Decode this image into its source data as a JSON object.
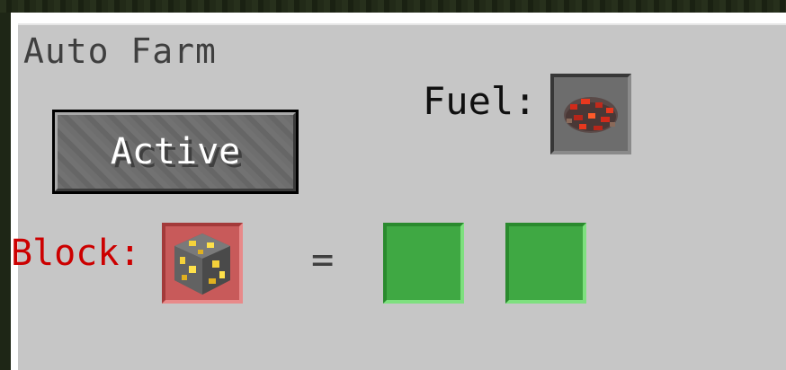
{
  "window": {
    "title": "Auto Farm"
  },
  "controls": {
    "toggle_label": "Active"
  },
  "fuel": {
    "label": "Fuel:",
    "item_icon": "redstone-ore-icon"
  },
  "target": {
    "label": "Block:",
    "label_color": "#cc0000",
    "item_icon": "gold-ore-icon",
    "equals": "="
  },
  "output_slots": [
    {
      "state": "empty",
      "color": "#3fa843"
    },
    {
      "state": "empty",
      "color": "#3fa843"
    }
  ]
}
